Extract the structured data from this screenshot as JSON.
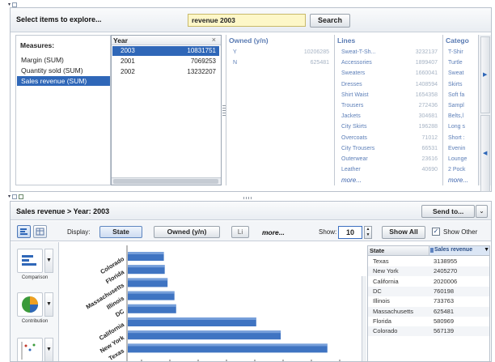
{
  "explorer": {
    "title": "Select items to explore...",
    "search_value": "revenue 2003",
    "search_button": "Search"
  },
  "measures": {
    "title": "Measures:",
    "items": [
      "Margin (SUM)",
      "Quantity sold (SUM)",
      "Sales revenue (SUM)"
    ],
    "selected_index": 2
  },
  "year": {
    "title": "Year",
    "rows": [
      {
        "label": "2003",
        "value": "10831751"
      },
      {
        "label": "2001",
        "value": "7069253"
      },
      {
        "label": "2002",
        "value": "13232207"
      }
    ],
    "selected_index": 0
  },
  "owned": {
    "title": "Owned (y/n)",
    "rows": [
      {
        "label": "Y",
        "value": "10206285"
      },
      {
        "label": "N",
        "value": "625481"
      }
    ]
  },
  "lines": {
    "title": "Lines",
    "rows": [
      {
        "label": "Sweat-T-Sh...",
        "value": "3232137"
      },
      {
        "label": "Accessories",
        "value": "1899407"
      },
      {
        "label": "Sweaters",
        "value": "1660041"
      },
      {
        "label": "Dresses",
        "value": "1408594"
      },
      {
        "label": "Shirt Waist",
        "value": "1654358"
      },
      {
        "label": "Trousers",
        "value": "272436"
      },
      {
        "label": "Jackets",
        "value": "304681"
      },
      {
        "label": "City Skirts",
        "value": "196288"
      },
      {
        "label": "Overcoats",
        "value": "71012"
      },
      {
        "label": "City Trousers",
        "value": "66531"
      },
      {
        "label": "Outerwear",
        "value": "23616"
      },
      {
        "label": "Leather",
        "value": "40690"
      }
    ],
    "more": "more..."
  },
  "category": {
    "title": "Catego",
    "rows": [
      "T-Shir",
      "Turtle",
      "Sweat",
      "Skirts",
      "Soft fa",
      "Sampl",
      "Belts,l",
      "Long s",
      "Short :",
      "Evenin",
      "Lounge",
      "2 Pock"
    ],
    "more": "more..."
  },
  "analysis": {
    "title": "Sales revenue > Year: 2003",
    "send_to": "Send to...",
    "display_label": "Display:",
    "display_buttons": [
      "State",
      "Owned (y/n)",
      "Li"
    ],
    "more": "more...",
    "show_label": "Show:",
    "show_value": "10",
    "show_all": "Show All",
    "show_other": "Show Other",
    "show_other_checked": true
  },
  "chart_types": [
    {
      "label": "Comparison",
      "icon": "bar-chart-icon"
    },
    {
      "label": "Contribution",
      "icon": "pie-chart-icon"
    },
    {
      "label": "",
      "icon": "scatter-chart-icon"
    }
  ],
  "chart_data": {
    "type": "bar",
    "orientation": "horizontal",
    "categories": [
      "Colorado",
      "Florida",
      "Massachusetts",
      "Illinois",
      "DC",
      "California",
      "New York",
      "Texas"
    ],
    "values": [
      567139,
      580969,
      625481,
      733763,
      760198,
      2020006,
      2405270,
      3138955
    ],
    "xlim": [
      0,
      3600000
    ],
    "color": "#3f74c2"
  },
  "table": {
    "headers": [
      "State",
      "Sales revenue"
    ],
    "rows": [
      [
        "Texas",
        "3138955"
      ],
      [
        "New York",
        "2405270"
      ],
      [
        "California",
        "2020006"
      ],
      [
        "DC",
        "760198"
      ],
      [
        "Illinois",
        "733763"
      ],
      [
        "Massachusetts",
        "625481"
      ],
      [
        "Florida",
        "580969"
      ],
      [
        "Colorado",
        "567139"
      ]
    ]
  },
  "colors": {
    "selection": "#2f67b8",
    "facet_text": "#5d7fb8",
    "search_bg": "#fdf7c8"
  }
}
